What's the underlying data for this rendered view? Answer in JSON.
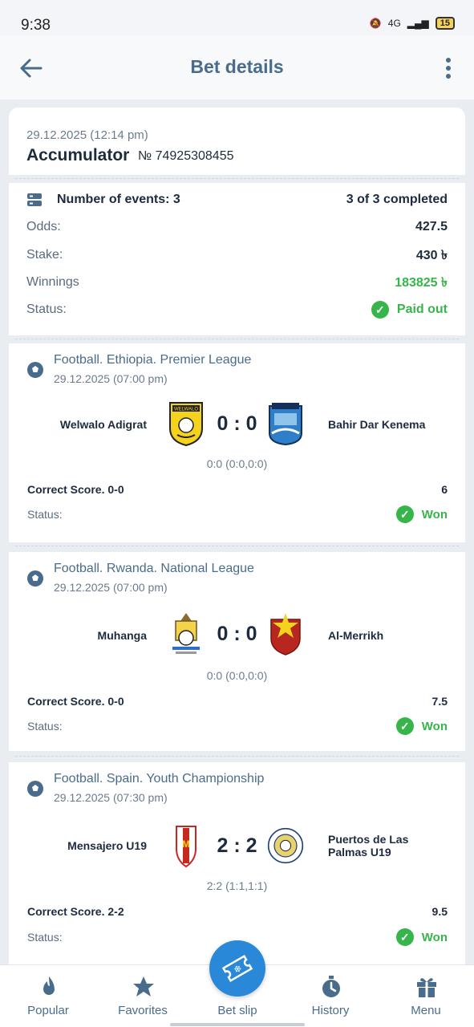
{
  "status_bar": {
    "time": "9:38",
    "network": "4G",
    "battery": "15"
  },
  "header": {
    "title": "Bet details"
  },
  "bet": {
    "date": "29.12.2025 (12:14 pm)",
    "type": "Accumulator",
    "number": "№ 74925308455",
    "events_label": "Number of events: 3",
    "events_completed": "3 of 3 completed",
    "odds_label": "Odds:",
    "odds": "427.5",
    "stake_label": "Stake:",
    "stake": "430 ৳",
    "winnings_label": "Winnings",
    "winnings": "183825 ৳",
    "status_label": "Status:",
    "status": "Paid out"
  },
  "events": [
    {
      "league": "Football. Ethiopia. Premier League",
      "date": "29.12.2025 (07:00 pm)",
      "team1": "Welwalo Adigrat",
      "team2": "Bahir Dar Kenema",
      "score": "0 : 0",
      "full_score": "0:0 (0:0,0:0)",
      "market": "Correct Score. 0-0",
      "odds": "6",
      "status_label": "Status:",
      "status": "Won",
      "logo1_text": "WELWALO"
    },
    {
      "league": "Football. Rwanda. National League",
      "date": "29.12.2025 (07:00 pm)",
      "team1": "Muhanga",
      "team2": "Al-Merrikh",
      "score": "0 : 0",
      "full_score": "0:0 (0:0,0:0)",
      "market": "Correct Score. 0-0",
      "odds": "7.5",
      "status_label": "Status:",
      "status": "Won"
    },
    {
      "league": "Football. Spain. Youth Championship",
      "date": "29.12.2025 (07:30 pm)",
      "team1": "Mensajero U19",
      "team2": "Puertos de Las Palmas U19",
      "score": "2 : 2",
      "full_score": "2:2 (1:1,1:1)",
      "market": "Correct Score. 2-2",
      "odds": "9.5",
      "status_label": "Status:",
      "status": "Won"
    }
  ],
  "nav": [
    {
      "label": "Popular",
      "icon": "flame-icon"
    },
    {
      "label": "Favorites",
      "icon": "star-icon"
    },
    {
      "label": "Bet slip",
      "icon": "ticket-icon"
    },
    {
      "label": "History",
      "icon": "stopwatch-icon"
    },
    {
      "label": "Menu",
      "icon": "gift-icon"
    }
  ],
  "colors": {
    "accent": "#2a88d8",
    "success": "#35b54a",
    "title": "#4a6c8c",
    "text": "#1d2b3e"
  }
}
